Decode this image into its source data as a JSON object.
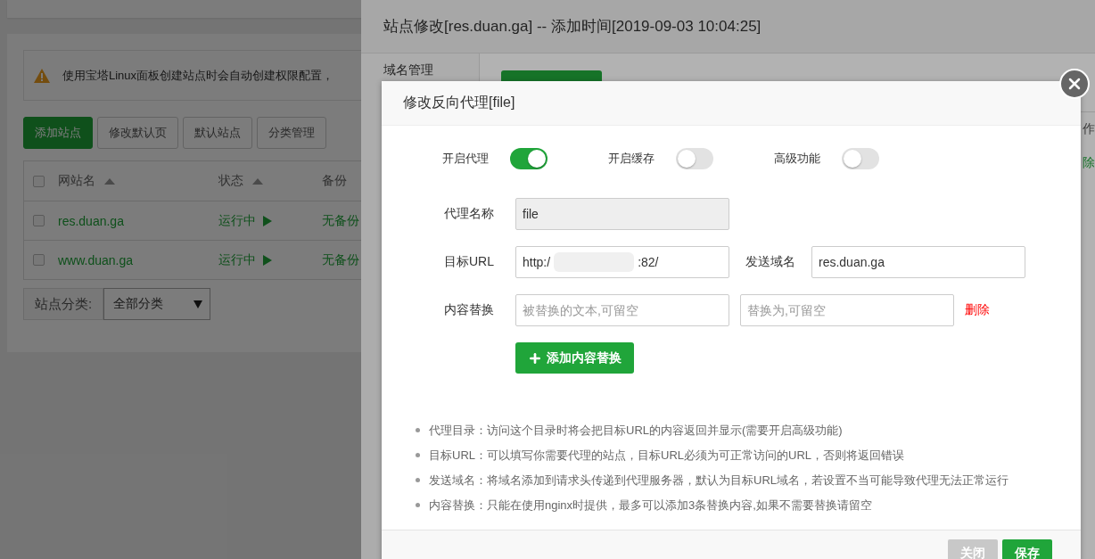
{
  "page": {
    "notice": "使用宝塔Linux面板创建站点时会自动创建权限配置，",
    "toolbar": [
      {
        "label": "添加站点",
        "kind": "primary"
      },
      {
        "label": "修改默认页",
        "kind": "plain"
      },
      {
        "label": "默认站点",
        "kind": "plain"
      },
      {
        "label": "分类管理",
        "kind": "plain"
      }
    ],
    "table": {
      "all_checked": false,
      "columns": [
        "网站名",
        "状态",
        "备份"
      ],
      "rows": [
        {
          "name": "res.duan.ga",
          "status": "运行中",
          "backup": "无备份",
          "checked": false
        },
        {
          "name": "www.duan.ga",
          "status": "运行中",
          "backup": "无备份",
          "checked": false
        }
      ]
    },
    "category": {
      "label": "站点分类:",
      "value": "全部分类"
    }
  },
  "site_dialog": {
    "title": "站点修改[res.duan.ga] -- 添加时间[2019-09-03 10:04:25]",
    "sidebar": [
      "域名管理"
    ],
    "column_tail": "作",
    "row_tail": "除"
  },
  "proxy_dialog": {
    "title": "修改反向代理[file]",
    "switches": [
      {
        "label": "开启代理",
        "on": true
      },
      {
        "label": "开启缓存",
        "on": false
      },
      {
        "label": "高级功能",
        "on": false
      }
    ],
    "name": {
      "label": "代理名称",
      "value": "file",
      "disabled": true
    },
    "target": {
      "label": "目标URL",
      "value_start": "http:/",
      "value_end": ":82/",
      "redacted": true
    },
    "send_domain": {
      "label": "发送域名",
      "value": "res.duan.ga"
    },
    "replace": {
      "label": "内容替换",
      "from_placeholder": "被替换的文本,可留空",
      "to_placeholder": "替换为,可留空",
      "delete": "删除"
    },
    "add_button": "添加内容替换",
    "notes": [
      "代理目录：访问这个目录时将会把目标URL的内容返回并显示(需要开启高级功能)",
      "目标URL：可以填写你需要代理的站点，目标URL必须为可正常访问的URL，否则将返回错误",
      "发送域名：将域名添加到请求头传递到代理服务器，默认为目标URL域名，若设置不当可能导致代理无法正常运行",
      "内容替换：只能在使用nginx时提供，最多可以添加3条替换内容,如果不需要替换请留空"
    ],
    "buttons": [
      {
        "label": "关闭",
        "kind": "close"
      },
      {
        "label": "保存",
        "kind": "save"
      }
    ]
  }
}
